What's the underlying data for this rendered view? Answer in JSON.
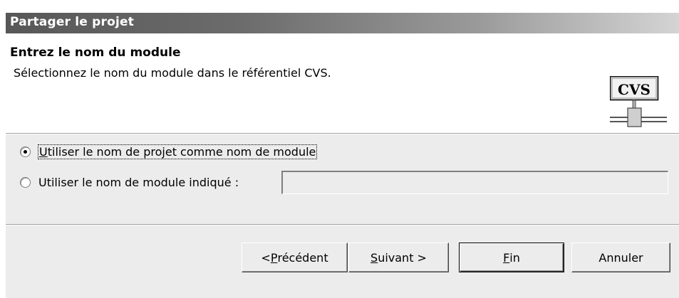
{
  "window": {
    "title": "Partager le projet"
  },
  "header": {
    "title": "Entrez le nom du module",
    "description": "Sélectionnez le nom du module dans le référentiel CVS.",
    "icon_text": "CVS",
    "icon": "cvs-repository-icon"
  },
  "options": {
    "use_project_name": {
      "access_key": "U",
      "rest": "tiliser le nom de projet comme nom de module",
      "checked": true
    },
    "use_specified_name": {
      "label": "Utiliser le nom de module indiqué :",
      "checked": false,
      "value": ""
    }
  },
  "buttons": {
    "back": {
      "prefix": "< ",
      "access_key": "P",
      "rest": "récédent"
    },
    "next": {
      "access_key": "S",
      "rest": "uivant >"
    },
    "finish": {
      "access_key": "F",
      "rest": "in"
    },
    "cancel": {
      "label": "Annuler"
    }
  }
}
